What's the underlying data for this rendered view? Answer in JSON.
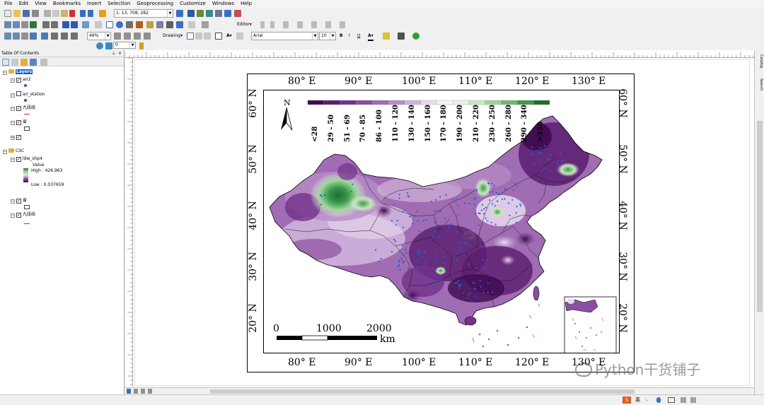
{
  "menu": [
    "File",
    "Edit",
    "View",
    "Bookmarks",
    "Insert",
    "Selection",
    "Geoprocessing",
    "Customize",
    "Windows",
    "Help"
  ],
  "toolbar": {
    "scale_value": "1: 13, 708, 282",
    "zoom_value": "46%",
    "drawing_label": "Drawing",
    "editor_label": "Editor",
    "font_name": "Arial",
    "font_size": "10",
    "bold": "B",
    "italic": "I",
    "underline": "U",
    "layer_value": "0"
  },
  "toc": {
    "title": "Table Of Contents",
    "items": {
      "layers": "Layers",
      "air2": "air2",
      "air_station": "air_station",
      "jiuduanxian1": "九段线",
      "sheng1": "省",
      "csc": "CSC",
      "ldw": "ldw_shp4",
      "value": "Value",
      "high": "High : 426.963",
      "low": "Low : 0.037659",
      "sheng2": "省",
      "jiuduanxian2": "九段线"
    }
  },
  "side_tabs": [
    "Catalog",
    "Search"
  ],
  "map": {
    "top_lon_labels": [
      "80° E",
      "90° E",
      "100° E",
      "110° E",
      "120° E",
      "130° E"
    ],
    "bottom_lon_labels": [
      "80° E",
      "90° E",
      "100° E",
      "110° E",
      "120° E",
      "130° E"
    ],
    "lat_labels": [
      "60° N",
      "50° N",
      "40° N",
      "30° N",
      "20° N"
    ],
    "north_label": "N",
    "scale_labels": [
      "0",
      "1000",
      "2000"
    ],
    "scale_unit": "km",
    "legend_classes": [
      "<28",
      "29 - 50",
      "51 - 69",
      "70 - 85",
      "86 - 100",
      "110 - 120",
      "130 - 140",
      "150 - 160",
      "170 - 180",
      "190 - 200",
      "210 - 220",
      "230 - 250",
      "260 - 280",
      "290 - 340",
      ">350"
    ],
    "legend_colors": [
      "#3f0a4f",
      "#5a1d6e",
      "#72328a",
      "#8a4f9f",
      "#a06cb3",
      "#b78dc7",
      "#cfb3da",
      "#e8dbee",
      "#f7f2f8",
      "#e6f3e3",
      "#c8e7c1",
      "#9fd49a",
      "#6dbb6f",
      "#3b9a4a",
      "#1d6d33"
    ]
  },
  "watermark": "Python干货铺子",
  "taskbar_text": "英"
}
